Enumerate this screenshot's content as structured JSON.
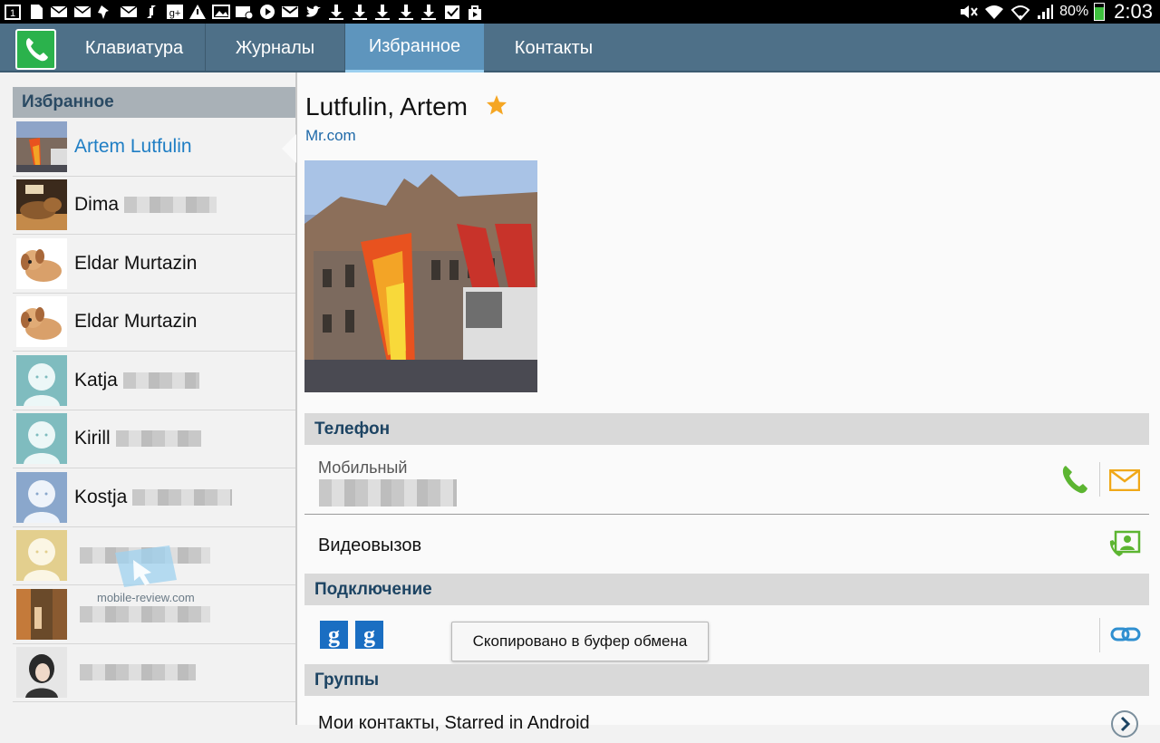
{
  "status_bar": {
    "notification_icons": [
      "sim-1-icon",
      "sim-card-icon",
      "mail-icon",
      "mail-icon",
      "pin-icon",
      "mail-icon",
      "sync-icon",
      "google-plus-icon",
      "warning-icon",
      "image-icon",
      "mail-at-icon",
      "play-icon",
      "gmail-icon",
      "twitter-icon",
      "download-icon",
      "download-icon",
      "download-icon",
      "download-icon",
      "download-icon",
      "checkbox-icon",
      "shopping-bag-icon"
    ],
    "battery": "80%",
    "time": "2:03",
    "colors": {
      "background": "#000000",
      "battery_fill": "#3ec13e"
    }
  },
  "tab_bar": {
    "tabs": [
      {
        "label": "Клавиатура",
        "active": false
      },
      {
        "label": "Журналы",
        "active": false
      },
      {
        "label": "Избранное",
        "active": true
      },
      {
        "label": "Контакты",
        "active": false
      }
    ],
    "colors": {
      "background": "#4e7088",
      "active": "#5e95bd"
    }
  },
  "favorites": {
    "header": "Избранное",
    "contacts": [
      {
        "name": "Artem Lutfulin",
        "avatar": "photo-building",
        "selected": true
      },
      {
        "name": "Dima",
        "avatar": "photo-dog",
        "selected": false
      },
      {
        "name": "Eldar Murtazin",
        "avatar": "plush-dog",
        "selected": false
      },
      {
        "name": "Eldar Murtazin",
        "avatar": "plush-dog",
        "selected": false
      },
      {
        "name": "Katja",
        "avatar": "default-teal",
        "selected": false
      },
      {
        "name": "Kirill",
        "avatar": "default-teal",
        "selected": false
      },
      {
        "name": "Kostja",
        "avatar": "default-blue",
        "selected": false
      },
      {
        "name": "",
        "avatar": "default-yellow",
        "selected": false
      },
      {
        "name": "",
        "avatar": "photo-street",
        "selected": false
      },
      {
        "name": "",
        "avatar": "photo-person",
        "selected": false
      }
    ]
  },
  "detail": {
    "name": "Lutfulin, Artem",
    "company": "Mr.com",
    "starred": true,
    "phone_section": "Телефон",
    "phone_type": "Мобильный",
    "video_call": "Видеовызов",
    "connection_section": "Подключение",
    "groups_section": "Группы",
    "groups_value": "Мои контакты, Starred in Android",
    "toast": "Скопировано в буфер обмена",
    "colors": {
      "accent_green": "#5cb531",
      "email_yellow": "#f0a818",
      "link_blue": "#1f6aa9",
      "star": "#f5a623"
    }
  },
  "watermark": "mobile-review.com"
}
